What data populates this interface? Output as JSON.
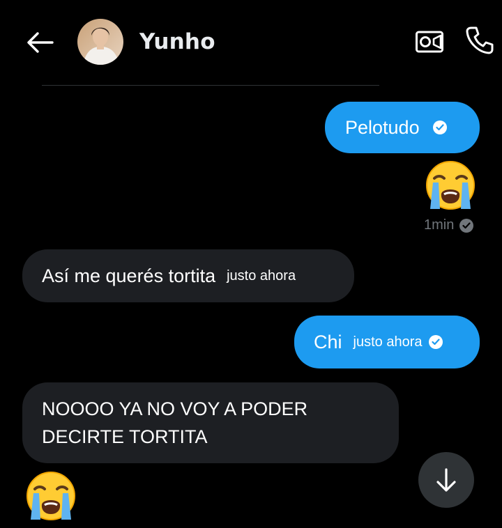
{
  "header": {
    "contact_name": "Yunho",
    "back_icon": "arrow-left-icon",
    "video_icon": "video-camera-icon",
    "call_icon": "phone-icon"
  },
  "messages": [
    {
      "direction": "sent",
      "text": "Pelotudo",
      "time": "",
      "read": true
    },
    {
      "direction": "sent",
      "emoji": "loudly-crying-face",
      "time": "1min",
      "read": true
    },
    {
      "direction": "received",
      "text": "Así me querés tortita",
      "time": "justo ahora"
    },
    {
      "direction": "sent",
      "text": "Chi",
      "time": "justo ahora",
      "read": true
    },
    {
      "direction": "received",
      "text": "NOOOO YA NO VOY A PODER DECIRTE TORTITA"
    },
    {
      "direction": "received",
      "emoji": "loudly-crying-face"
    }
  ],
  "colors": {
    "sent_bubble": "#1d9bf0",
    "received_bubble": "#1d1f23",
    "background": "#000000",
    "meta_text": "#71767b"
  },
  "scroll_button_icon": "arrow-down-icon"
}
